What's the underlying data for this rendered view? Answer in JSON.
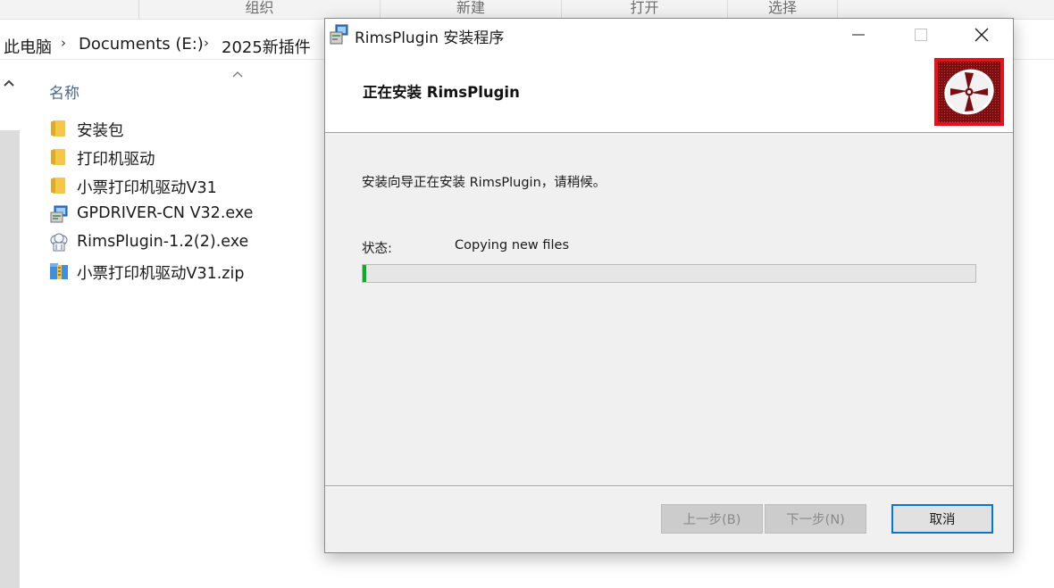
{
  "explorer": {
    "ribbon_groups": [
      "组织",
      "新建",
      "打开",
      "选择"
    ],
    "breadcrumb": [
      "此电脑",
      "Documents (E:)",
      "2025新插件"
    ],
    "column_header": "名称",
    "files": [
      {
        "name": "安装包",
        "icon": "folder-icon"
      },
      {
        "name": "打印机驱动",
        "icon": "folder-icon"
      },
      {
        "name": "小票打印机驱动V31",
        "icon": "folder-icon"
      },
      {
        "name": "GPDRIVER-CN V32.exe",
        "icon": "installer-exe-icon"
      },
      {
        "name": "RimsPlugin-1.2(2).exe",
        "icon": "chef-hat-exe-icon"
      },
      {
        "name": "小票打印机驱动V31.zip",
        "icon": "zip-archive-icon"
      }
    ]
  },
  "dialog": {
    "title": "RimsPlugin 安装程序",
    "heading": "正在安装 RimsPlugin",
    "message": "安装向导正在安装 RimsPlugin，请稍候。",
    "status_label": "状态:",
    "status_value": "Copying new files",
    "progress_fraction": 0.006,
    "buttons": {
      "back": "上一步(B)",
      "next": "下一步(N)",
      "cancel": "取消"
    },
    "colors": {
      "progress_green": "#06b025",
      "logo_red": "#e0141a",
      "focus_blue": "#0078d7"
    }
  }
}
